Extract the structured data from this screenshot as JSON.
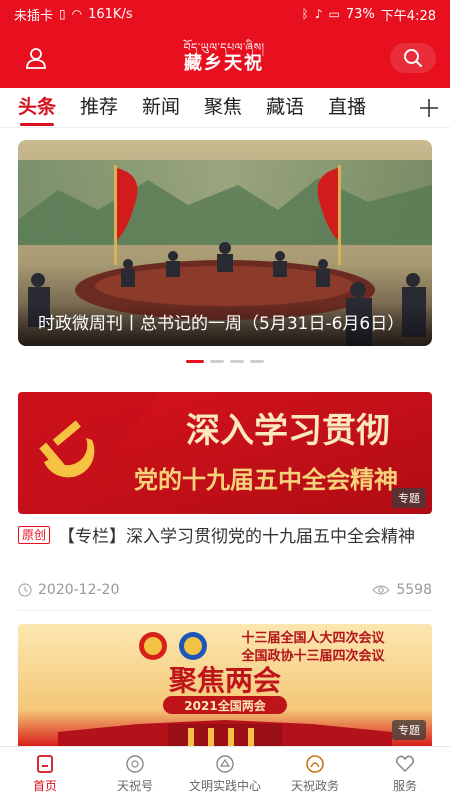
{
  "status_bar": {
    "carrier": "未插卡",
    "speed": "161K/s",
    "battery": "73%",
    "time": "下午4:28"
  },
  "header": {
    "logo_tibetan": "བོད་ཡུལ་དཔལ་ཞིས།",
    "logo_chinese": "藏乡天祝",
    "left_icon": "user-icon",
    "right_icon": "search-icon"
  },
  "tabs": [
    {
      "label": "头条",
      "active": true
    },
    {
      "label": "推荐",
      "active": false
    },
    {
      "label": "新闻",
      "active": false
    },
    {
      "label": "聚焦",
      "active": false
    },
    {
      "label": "藏语",
      "active": false
    },
    {
      "label": "直播",
      "active": false
    }
  ],
  "banner": {
    "caption": "时政微周刊丨总书记的一周（5月31日-6月6日）",
    "dots": 4,
    "active_dot": 0
  },
  "article1": {
    "image_line1": "深入学习贯彻",
    "image_line2": "党的十九届五中全会精神",
    "image_tag": "专题",
    "badge": "原创",
    "title": "【专栏】深入学习贯彻党的十九届五中全会精神",
    "date": "2020-12-20",
    "views": "5598"
  },
  "article2": {
    "line1": "十三届全国人大四次会议",
    "line2": "全国政协十三届四次会议",
    "headline": "聚焦两会",
    "sub": "2021全国两会",
    "image_tag": "专题"
  },
  "bottom_nav": [
    {
      "label": "首页",
      "icon": "home-icon",
      "active": true
    },
    {
      "label": "天祝号",
      "icon": "emblem-icon",
      "active": false
    },
    {
      "label": "文明实践中心",
      "icon": "badge-icon",
      "active": false
    },
    {
      "label": "天祝政务",
      "icon": "government-icon",
      "active": false
    },
    {
      "label": "服务",
      "icon": "heart-icon",
      "active": false
    }
  ],
  "colors": {
    "brand_red": "#e8101f",
    "active_red": "#d6101c"
  }
}
